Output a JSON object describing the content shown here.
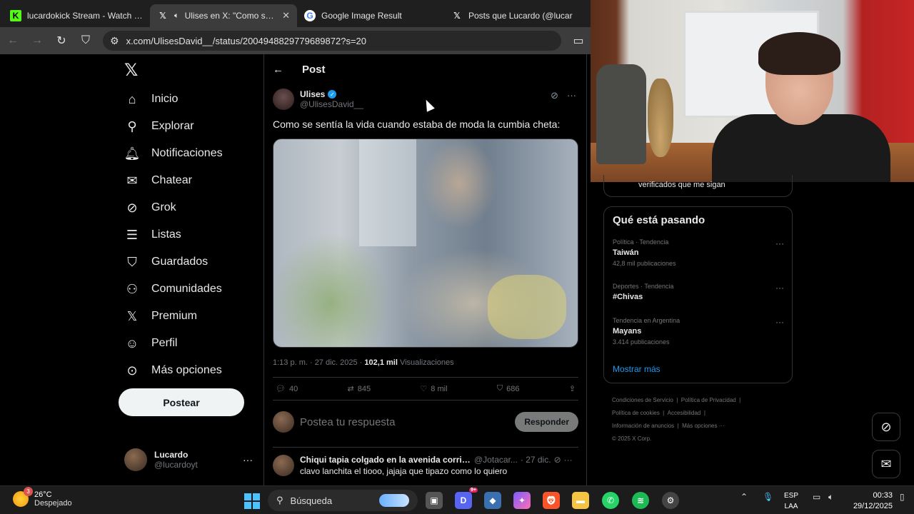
{
  "browser": {
    "tabs": [
      {
        "title": "lucardokick Stream - Watch Live o",
        "icon": "kick-icon",
        "active": false
      },
      {
        "title": "Ulises en X: \"Como se sent",
        "icon": "x-icon",
        "active": true
      },
      {
        "title": "Google Image Result",
        "icon": "google-icon",
        "active": false
      },
      {
        "title": "Posts que Lucardo (@lucar",
        "icon": "x-icon",
        "active": false
      }
    ],
    "url": "x.com/UlisesDavid__/status/2004948829779689872?s=20"
  },
  "nav": {
    "items": [
      {
        "label": "Inicio",
        "icon": "home-icon"
      },
      {
        "label": "Explorar",
        "icon": "search-icon"
      },
      {
        "label": "Notificaciones",
        "icon": "bell-icon"
      },
      {
        "label": "Chatear",
        "icon": "mail-icon"
      },
      {
        "label": "Grok",
        "icon": "grok-icon"
      },
      {
        "label": "Listas",
        "icon": "list-icon"
      },
      {
        "label": "Guardados",
        "icon": "bookmark-icon"
      },
      {
        "label": "Comunidades",
        "icon": "people-icon"
      },
      {
        "label": "Premium",
        "icon": "x-icon"
      },
      {
        "label": "Perfil",
        "icon": "person-icon"
      },
      {
        "label": "Más opciones",
        "icon": "more-circle-icon"
      }
    ],
    "post_button": "Postear",
    "account": {
      "name": "Lucardo",
      "handle": "@lucardoyt"
    }
  },
  "post": {
    "header": "Post",
    "author_name": "Ulises",
    "author_handle": "@UlisesDavid__",
    "text": "Como se sentía la vida cuando estaba de moda la cumbia cheta:",
    "time": "1:13 p. m. · 27 dic. 2025 · ",
    "views_count": "102,1 mil",
    "views_label": " Visualizaciones",
    "stats": {
      "replies": "40",
      "reposts": "845",
      "likes": "8 mil",
      "bookmarks": "686"
    },
    "reply_placeholder": "Postea tu respuesta",
    "reply_button": "Responder"
  },
  "comment": {
    "name": "Chiqui tapia colgado en la avenida corrient...",
    "handle": "@Jotacar...",
    "date": "· 27 dic.",
    "text": "clavo lanchita el tiooo, jajaja que tipazo como lo quiero"
  },
  "sidebar": {
    "verified_text": "verificados que me sigan",
    "trends_title": "Qué está pasando",
    "trends": [
      {
        "context": "Política · Tendencia",
        "title": "Taiwán",
        "count": "42,8 mil publicaciones"
      },
      {
        "context": "Deportes · Tendencia",
        "title": "#Chivas",
        "count": ""
      },
      {
        "context": "Tendencia en Argentina",
        "title": "Mayans",
        "count": "3.414 publicaciones"
      }
    ],
    "show_more": "Mostrar más",
    "footer": {
      "l1a": "Condiciones de Servicio",
      "l1b": "Política de Privacidad",
      "l2a": "Política de cookies",
      "l2b": "Accesibilidad",
      "l3a": "Información de anuncios",
      "l3b": "Más opciones ···",
      "l4": "© 2025 X Corp."
    }
  },
  "taskbar": {
    "temp": "26°C",
    "weather": "Despejado",
    "weather_badge": "3",
    "search": "Búsqueda",
    "lang1": "ESP",
    "lang2": "LAA",
    "time": "00:33",
    "date": "29/12/2025",
    "discord_badge": "9+"
  }
}
